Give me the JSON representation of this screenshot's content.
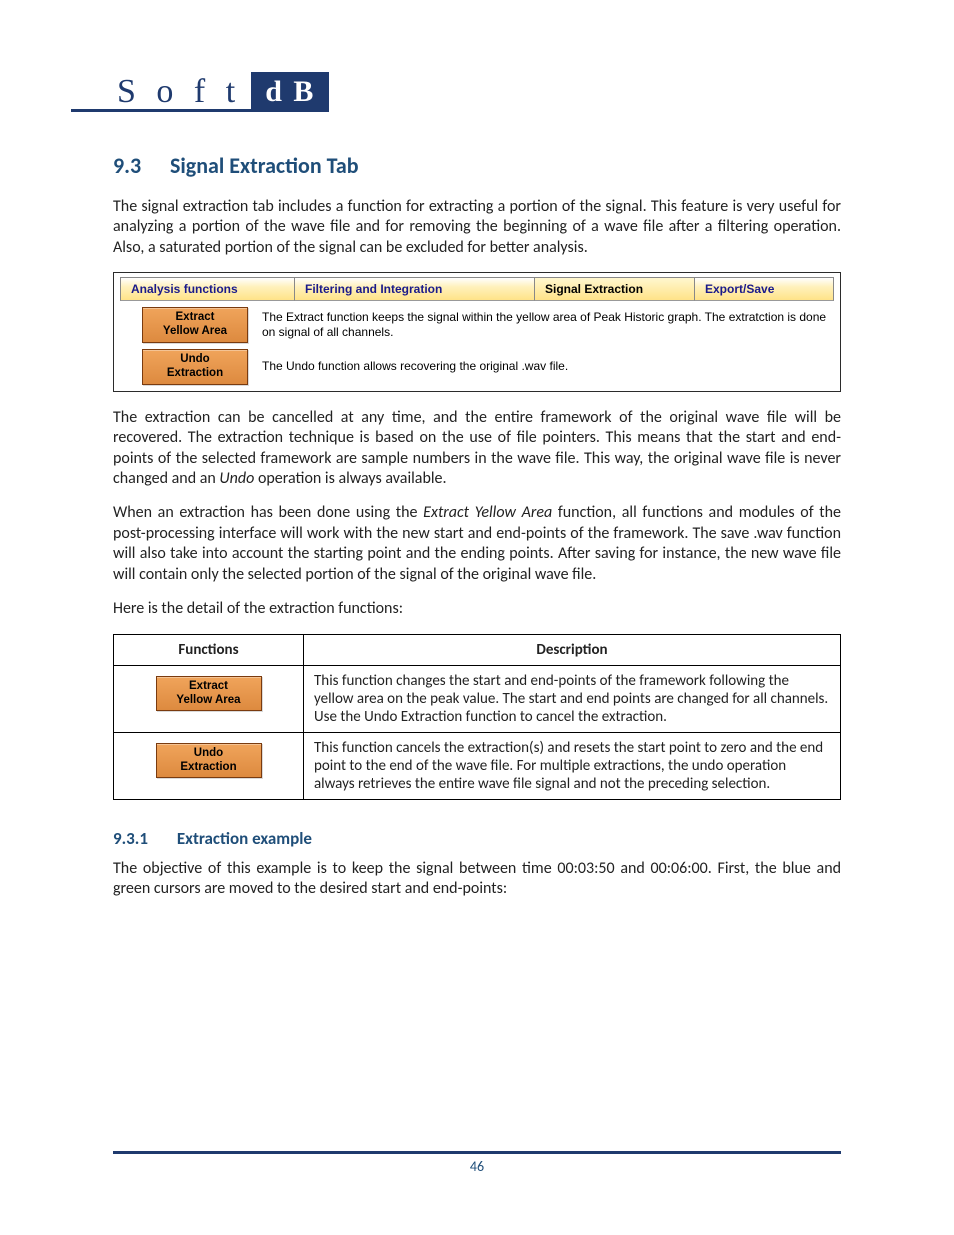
{
  "logo": {
    "left": "S o f t",
    "right": "d B"
  },
  "section": {
    "num": "9.3",
    "title": "Signal Extraction Tab"
  },
  "para1": "The signal extraction tab includes a function for extracting a portion of the signal. This feature is very useful for analyzing a portion of the wave file and for removing the beginning of a wave file after a filtering operation. Also, a saturated portion of the signal can be excluded for better analysis.",
  "ui": {
    "tabs": {
      "analysis": "Analysis functions",
      "filtering": "Filtering and Integration",
      "signal": "Signal Extraction",
      "export": "Export/Save"
    },
    "rows": [
      {
        "btn": "Extract\nYellow Area",
        "desc": "The Extract function keeps the signal within the yellow area of Peak Historic graph. The extratction is done on signal of all channels."
      },
      {
        "btn": "Undo\nExtraction",
        "desc": "The Undo function allows recovering the original .wav file."
      }
    ]
  },
  "para2_a": "The extraction can be cancelled at any time, and the entire framework of the original wave file will be recovered. The extraction technique is based on the use of file pointers. This means that the start and end-points of the selected framework are sample numbers in the wave file. This way, the original wave file is never changed and an ",
  "para2_ital": "Undo",
  "para2_b": " operation is always available.",
  "para3_a": "When an extraction has been done using the ",
  "para3_ital": "Extract Yellow Area",
  "para3_b": " function, all functions and modules of the post-processing interface will work with the new start and end-points of the framework. The save .wav function will also take into account the starting point and the ending points. After saving for instance, the new wave file will contain only the selected portion of the signal of the original wave file.",
  "para4": "Here is the detail of the extraction functions:",
  "table": {
    "head": {
      "fn": "Functions",
      "desc": "Description"
    },
    "rows": [
      {
        "btn": "Extract\nYellow Area",
        "desc": "This function changes the start and end-points of the framework following the yellow area on the peak value. The start and end points are changed for all channels. Use the Undo Extraction function to cancel the extraction."
      },
      {
        "btn": "Undo\nExtraction",
        "desc": "This function cancels the extraction(s) and resets the start point to zero and the end point to the end of the wave file. For multiple extractions, the undo operation always retrieves the entire wave file signal and not the preceding selection."
      }
    ]
  },
  "subsection": {
    "num": "9.3.1",
    "title": "Extraction example"
  },
  "para5": "The objective of this example is to keep the signal between time 00:03:50 and 00:06:00. First, the blue and green cursors are moved to the desired start and end-points:",
  "page_number": "46"
}
